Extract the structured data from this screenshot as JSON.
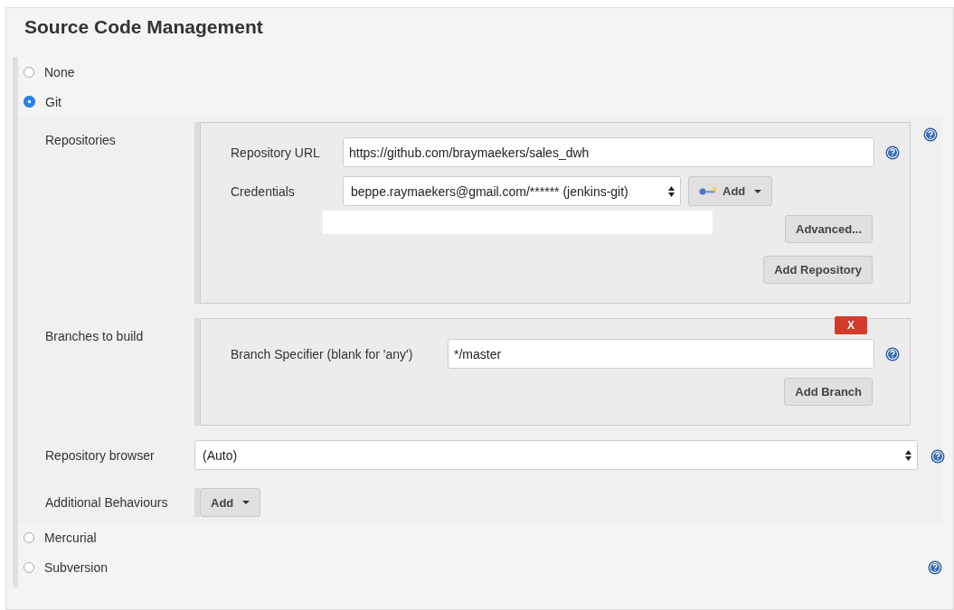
{
  "section": {
    "title": "Source Code Management"
  },
  "scm_options": [
    {
      "label": "None",
      "selected": false,
      "help": false
    },
    {
      "label": "Git",
      "selected": true,
      "help": false
    },
    {
      "label": "Mercurial",
      "selected": false,
      "help": false
    },
    {
      "label": "Subversion",
      "selected": false,
      "help": true
    }
  ],
  "git": {
    "repositories": {
      "label": "Repositories",
      "repository_url": {
        "label": "Repository URL",
        "value": "https://github.com/braymaekers/sales_dwh"
      },
      "credentials": {
        "label": "Credentials",
        "value": "beppe.raymaekers@gmail.com/****** (jenkins-git)"
      },
      "add_button": "Add",
      "advanced_button": "Advanced...",
      "add_repository_button": "Add Repository"
    },
    "branches": {
      "label": "Branches to build",
      "delete_button": "X",
      "branch_specifier": {
        "label": "Branch Specifier (blank for 'any')",
        "value": "*/master"
      },
      "add_branch_button": "Add Branch"
    },
    "repository_browser": {
      "label": "Repository browser",
      "value": "(Auto)"
    },
    "additional_behaviours": {
      "label": "Additional Behaviours",
      "add_button": "Add"
    }
  }
}
